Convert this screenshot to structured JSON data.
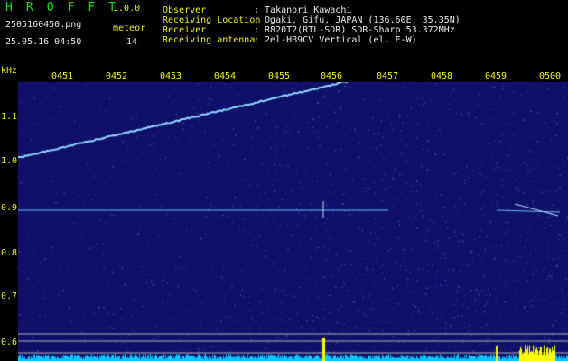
{
  "app": {
    "title": "H R O F F T",
    "version": "1.0.0",
    "filename": "2505160450.png",
    "datetime": "25.05.16 04:50",
    "meteor_label": "meteor",
    "meteor_count": "14"
  },
  "info": {
    "keys": "Observer\nReceiving Location\nReceiver\nReceiving antenna",
    "values": ": Takanori Kawachi\n: Ogaki, Gifu, JAPAN (136.60E, 35.35N)\n: R820T2(RTL-SDR) SDR-Sharp 53.372MHz\n: 2el-HB9CV Vertical (el. E-W)"
  },
  "axis": {
    "unit": "kHz",
    "time_labels": [
      "0451",
      "0452",
      "0453",
      "0454",
      "0455",
      "0456",
      "0457",
      "0458",
      "0459",
      "0500"
    ],
    "freq_labels": [
      "1.1",
      "1.0",
      "0.9",
      "0.8",
      "0.7",
      "0.6"
    ]
  },
  "colors": {
    "background": "#10106a",
    "trace": "#8fd8ff",
    "label": "#f0f000",
    "title": "#00e000",
    "text": "#e8e8e8",
    "baseline": "#00c8ff",
    "meteor_echo": "#ffff00"
  }
}
